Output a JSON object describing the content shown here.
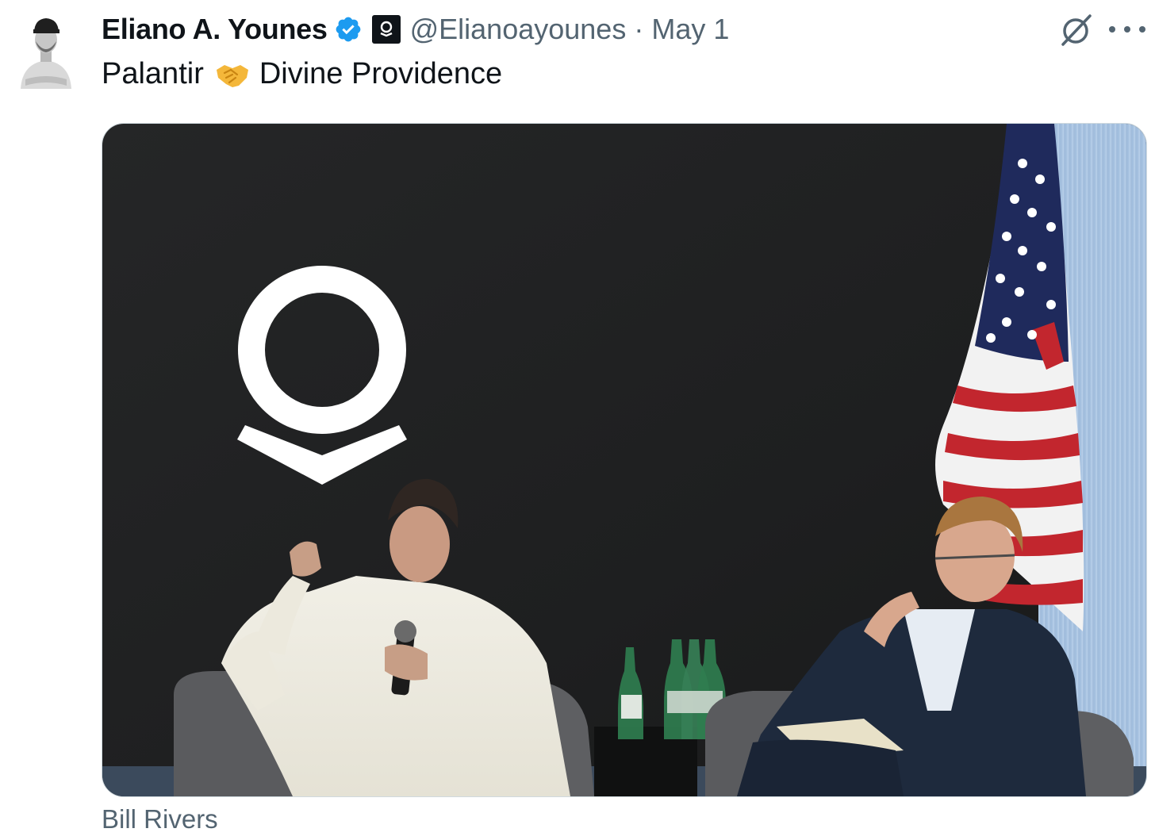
{
  "tweet": {
    "author_name": "Eliano A. Younes",
    "verified_icon": "verified-badge-icon",
    "affiliation_icon": "palantir-affiliate-icon",
    "handle": "@Elianoayounes",
    "separator": "·",
    "date": "May 1",
    "text_before": "Palantir",
    "emoji": "handshake-emoji",
    "text_after": "Divine Providence",
    "media_caption": "Bill Rivers",
    "grok_icon": "grok-icon",
    "more_icon": "more-options-icon",
    "colors": {
      "verified_blue": "#1d9bf0",
      "secondary_text": "#536471",
      "primary_text": "#0f1419"
    }
  }
}
